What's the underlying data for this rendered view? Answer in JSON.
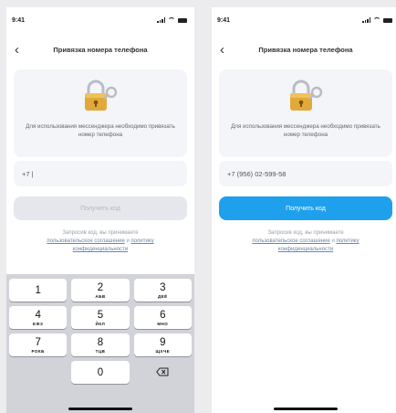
{
  "left_screen": {
    "status": {
      "time": "9:41"
    },
    "header": {
      "back_icon": "chevron-left-icon",
      "title": "Привязка номера телефона"
    },
    "card": {
      "illustration": "padlock-key-icon",
      "text": "Для использования мессенджера необходимо привязать номер телефона"
    },
    "phone_field": {
      "value": "+7 |"
    },
    "submit": {
      "label": "Получить код",
      "state": "disabled"
    },
    "terms": {
      "prefix": "Запросив код, вы принимаете",
      "link_agreement": "пользовательское соглашение",
      "connector": " и ",
      "link_policy": "политику конфиденциальности"
    },
    "keypad": {
      "rows": [
        [
          {
            "digit": "1",
            "letters": ""
          },
          {
            "digit": "2",
            "letters": "АБВ"
          },
          {
            "digit": "3",
            "letters": "ДЕЁ"
          }
        ],
        [
          {
            "digit": "4",
            "letters": "ЕЖЗ"
          },
          {
            "digit": "5",
            "letters": "ЙКЛ"
          },
          {
            "digit": "6",
            "letters": "МНО"
          }
        ],
        [
          {
            "digit": "7",
            "letters": "РОКБ"
          },
          {
            "digit": "8",
            "letters": "ТЦВ"
          },
          {
            "digit": "9",
            "letters": "ЩХЧЕ"
          }
        ]
      ],
      "zero": "0",
      "delete_icon": "backspace-icon"
    }
  },
  "right_screen": {
    "status": {
      "time": "9:41"
    },
    "header": {
      "back_icon": "chevron-left-icon",
      "title": "Привязка номера телефона"
    },
    "card": {
      "illustration": "padlock-key-icon",
      "text": "Для использования мессенджера необходимо привязать номер телефона"
    },
    "phone_field": {
      "value": "+7 (956) 02-599-58"
    },
    "submit": {
      "label": "Получить код",
      "state": "active"
    },
    "terms": {
      "prefix": "Запросив код, вы принимаете",
      "link_agreement": "пользовательское соглашение",
      "connector": " и ",
      "link_policy": "политику конфиденциальности"
    }
  },
  "colors": {
    "accent": "#1fa0ec",
    "disabled_button": "#e5e7ec",
    "card_bg": "#f3f5f9",
    "keypad_bg": "#d1d3d9"
  }
}
